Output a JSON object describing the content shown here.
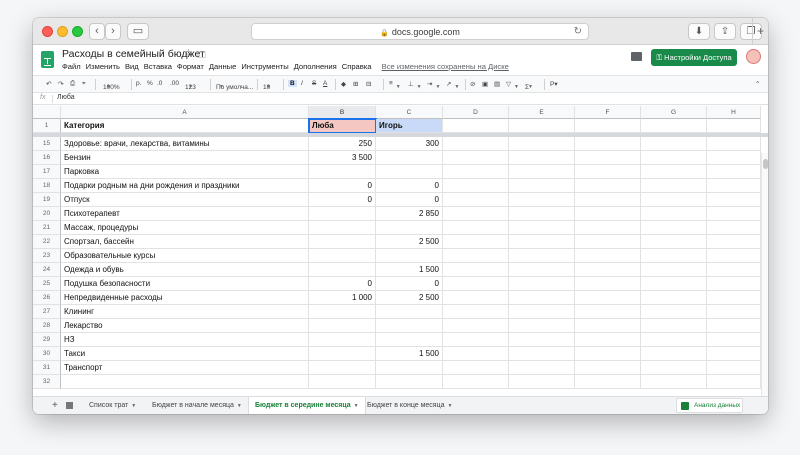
{
  "browser": {
    "url": "docs.google.com"
  },
  "doc": {
    "title": "Расходы в семейный бюджет",
    "menu": [
      "Файл",
      "Изменить",
      "Вид",
      "Вставка",
      "Формат",
      "Данные",
      "Инструменты",
      "Дополнения",
      "Справка"
    ],
    "saved_status": "Все изменения сохранены на Диске",
    "share_label": "Настройки Доступа"
  },
  "toolbar": {
    "zoom": "100%",
    "currency": "р.",
    "percent": "%",
    "dec_less": ".0",
    "dec_more": ".00",
    "format": "123",
    "font": "По умолча...",
    "font_size": "10",
    "bold": "B",
    "italic": "I",
    "strike": "S",
    "text_color": "A",
    "fill": "◆",
    "sigma": "Σ"
  },
  "formula_bar": {
    "fx": "fx",
    "value": "Люба"
  },
  "columns": [
    "A",
    "B",
    "C",
    "D",
    "E",
    "F",
    "G",
    "H"
  ],
  "header_row": {
    "num": "1",
    "category": "Категория",
    "lyuba": "Люба",
    "igor": "Игорь"
  },
  "rows": [
    {
      "num": "15",
      "category": "Здоровье: врачи, лекарства, витамины",
      "lyuba": "250",
      "igor": "300"
    },
    {
      "num": "16",
      "category": "Бензин",
      "lyuba": "3 500",
      "igor": ""
    },
    {
      "num": "17",
      "category": "Парковка",
      "lyuba": "",
      "igor": ""
    },
    {
      "num": "18",
      "category": "Подарки родным на дни рождения и праздники",
      "lyuba": "0",
      "igor": "0"
    },
    {
      "num": "19",
      "category": "Отпуск",
      "lyuba": "0",
      "igor": "0"
    },
    {
      "num": "20",
      "category": "Психотерапевт",
      "lyuba": "",
      "igor": "2 850"
    },
    {
      "num": "21",
      "category": "Массаж, процедуры",
      "lyuba": "",
      "igor": ""
    },
    {
      "num": "22",
      "category": "Спортзал, бассейн",
      "lyuba": "",
      "igor": "2 500"
    },
    {
      "num": "23",
      "category": "Образовательные курсы",
      "lyuba": "",
      "igor": ""
    },
    {
      "num": "24",
      "category": "Одежда и обувь",
      "lyuba": "",
      "igor": "1 500"
    },
    {
      "num": "25",
      "category": "Подушка безопасности",
      "lyuba": "0",
      "igor": "0"
    },
    {
      "num": "26",
      "category": "Непредвиденные расходы",
      "lyuba": "1 000",
      "igor": "2 500"
    },
    {
      "num": "27",
      "category": "Клининг",
      "lyuba": "",
      "igor": ""
    },
    {
      "num": "28",
      "category": "Лекарство",
      "lyuba": "",
      "igor": ""
    },
    {
      "num": "29",
      "category": "НЗ",
      "lyuba": "",
      "igor": ""
    },
    {
      "num": "30",
      "category": "Такси",
      "lyuba": "",
      "igor": "1 500"
    },
    {
      "num": "31",
      "category": "Транспорт",
      "lyuba": "",
      "igor": ""
    },
    {
      "num": "32",
      "category": "",
      "lyuba": "",
      "igor": ""
    }
  ],
  "sheet_tabs": [
    {
      "label": "Список трат",
      "active": false
    },
    {
      "label": "Бюджет в начале месяца",
      "active": false
    },
    {
      "label": "Бюджет в середине месяца",
      "active": true
    },
    {
      "label": "Бюджет в конце месяца",
      "active": false
    }
  ],
  "explore_label": "Анализ данных",
  "colors": {
    "lyuba_header": "#f4c7c3",
    "igor_header": "#c9daf8",
    "share_button": "#1a8a4a",
    "active_tab": "#188038"
  }
}
